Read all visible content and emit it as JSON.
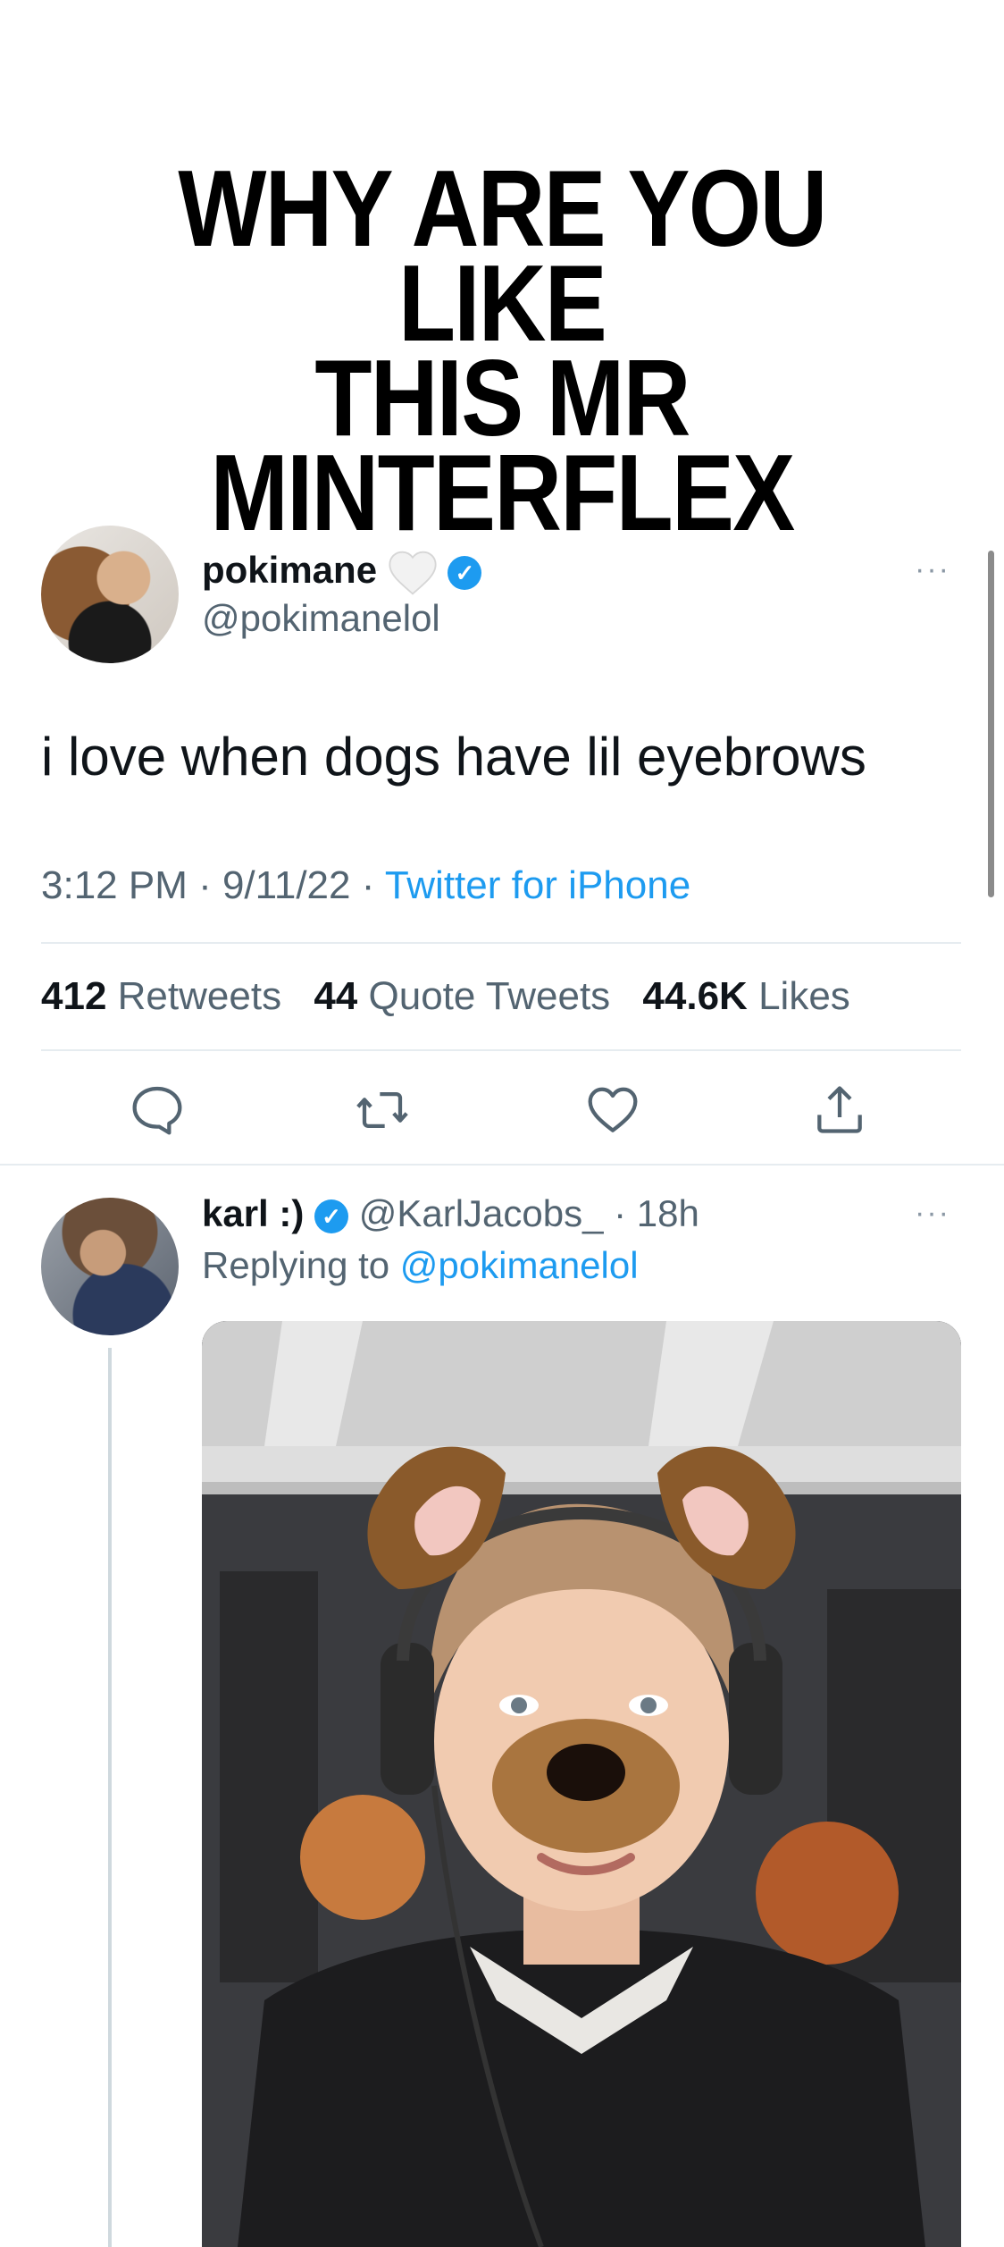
{
  "caption": {
    "line1": "WHY ARE YOU LIKE",
    "line2": "THIS MR MINTERFLEX"
  },
  "tweet": {
    "name": "pokimane",
    "handle": "@pokimanelol",
    "text": "i love when dogs have lil eyebrows",
    "time": "3:12 PM · 9/11/22 · ",
    "source": "Twitter for iPhone",
    "stats": {
      "retweets_count": "412",
      "retweets_label": "Retweets",
      "quotes_count": "44",
      "quotes_label": "Quote Tweets",
      "likes_count": "44.6K",
      "likes_label": "Likes"
    },
    "more": "···"
  },
  "reply": {
    "name": "karl :)",
    "handle": "@KarlJacobs_ · 18h",
    "replying_prefix": "Replying to ",
    "replying_to": "@pokimanelol",
    "more": "···"
  },
  "colors": {
    "accent": "#1d9bf0",
    "muted": "#536471",
    "divider": "#e6ecf0"
  },
  "icons": [
    "reply-icon",
    "retweet-icon",
    "like-icon",
    "share-icon",
    "verified-icon",
    "white-heart-icon",
    "more-icon"
  ]
}
